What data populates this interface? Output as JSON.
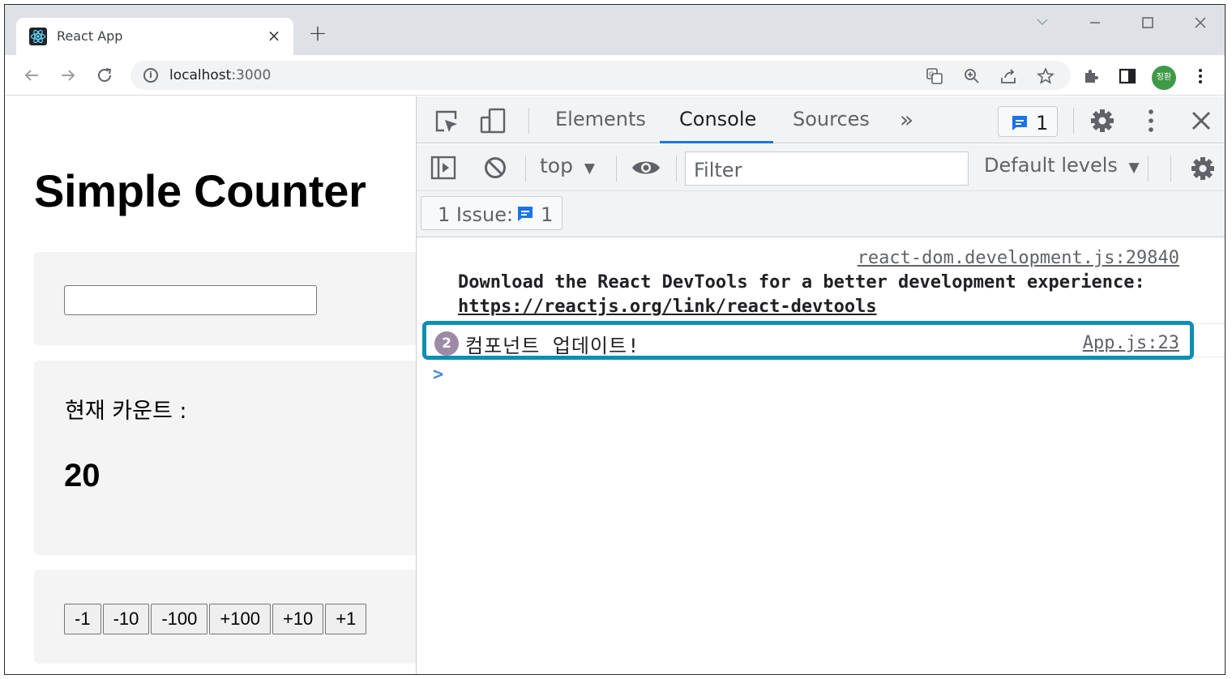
{
  "browser": {
    "tab_title": "React App",
    "tab_close": "×",
    "new_tab": "+",
    "url_host": "localhost",
    "url_port": ":3000",
    "avatar_label": "정환"
  },
  "page": {
    "title": "Simple Counter",
    "step_input_value": "",
    "count_label": "현재 카운트 :",
    "count_value": "20",
    "buttons": [
      "-1",
      "-10",
      "-100",
      "+100",
      "+10",
      "+1"
    ]
  },
  "devtools": {
    "tabs": [
      "Elements",
      "Console",
      "Sources"
    ],
    "more_tabs": "»",
    "issue_badge_count": "1",
    "context": "top",
    "filter_placeholder": "Filter",
    "levels": "Default levels",
    "issues_label": "1 Issue:",
    "issues_count": "1",
    "messages": [
      {
        "source": "react-dom.development.js:29840",
        "text": "Download the React DevTools for a better development experience:",
        "link": "https://reactjs.org/link/react-devtools"
      },
      {
        "repeat": "2",
        "text": "컴포넌트 업데이트!",
        "source": "App.js:23"
      }
    ],
    "prompt": ">"
  },
  "colors": {
    "highlight": "#0c8fb0",
    "active_tab_underline": "#1a73e8",
    "avatar": "#3f9a47"
  }
}
